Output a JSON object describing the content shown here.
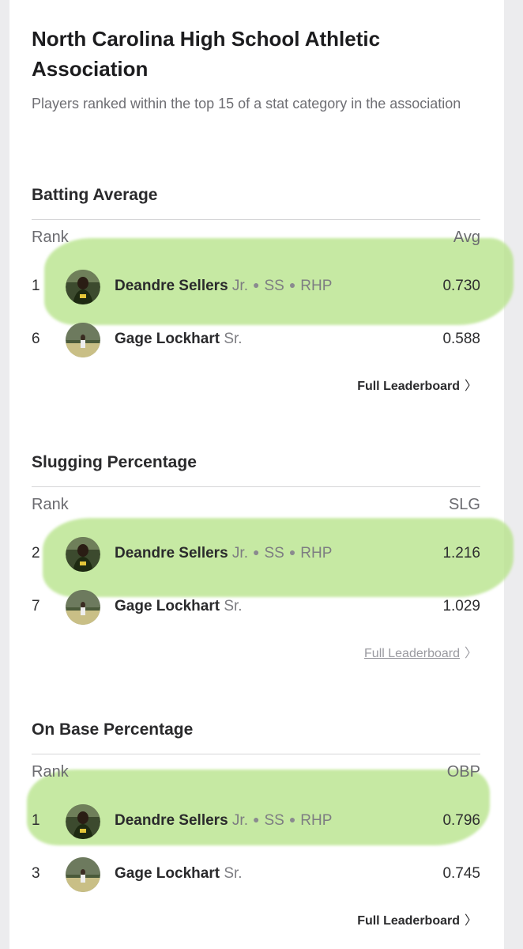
{
  "header": {
    "title": "North Carolina High School Athletic Association",
    "subtitle": "Players ranked within the top 15 of a stat category in the association"
  },
  "sections": [
    {
      "title": "Batting Average",
      "rank_header": "Rank",
      "stat_header": "Avg",
      "rows": [
        {
          "rank": "1",
          "name": "Deandre Sellers",
          "class_year": "Jr.",
          "positions": [
            "SS",
            "RHP"
          ],
          "value": "0.730"
        },
        {
          "rank": "6",
          "name": "Gage Lockhart",
          "class_year": "Sr.",
          "positions": [],
          "value": "0.588"
        }
      ],
      "link_label": "Full Leaderboard"
    },
    {
      "title": "Slugging Percentage",
      "rank_header": "Rank",
      "stat_header": "SLG",
      "rows": [
        {
          "rank": "2",
          "name": "Deandre Sellers",
          "class_year": "Jr.",
          "positions": [
            "SS",
            "RHP"
          ],
          "value": "1.216"
        },
        {
          "rank": "7",
          "name": "Gage Lockhart",
          "class_year": "Sr.",
          "positions": [],
          "value": "1.029"
        }
      ],
      "link_label": "Full Leaderboard"
    },
    {
      "title": "On Base Percentage",
      "rank_header": "Rank",
      "stat_header": "OBP",
      "rows": [
        {
          "rank": "1",
          "name": "Deandre Sellers",
          "class_year": "Jr.",
          "positions": [
            "SS",
            "RHP"
          ],
          "value": "0.796"
        },
        {
          "rank": "3",
          "name": "Gage Lockhart",
          "class_year": "Sr.",
          "positions": [],
          "value": "0.745"
        }
      ],
      "link_label": "Full Leaderboard"
    }
  ],
  "colors": {
    "highlight": "#b7e38a",
    "text_primary": "#2a2a2c",
    "text_secondary": "#6e6e73"
  },
  "icons": {
    "chevron": "chevron-right-icon",
    "separator": "dot-separator-icon"
  }
}
